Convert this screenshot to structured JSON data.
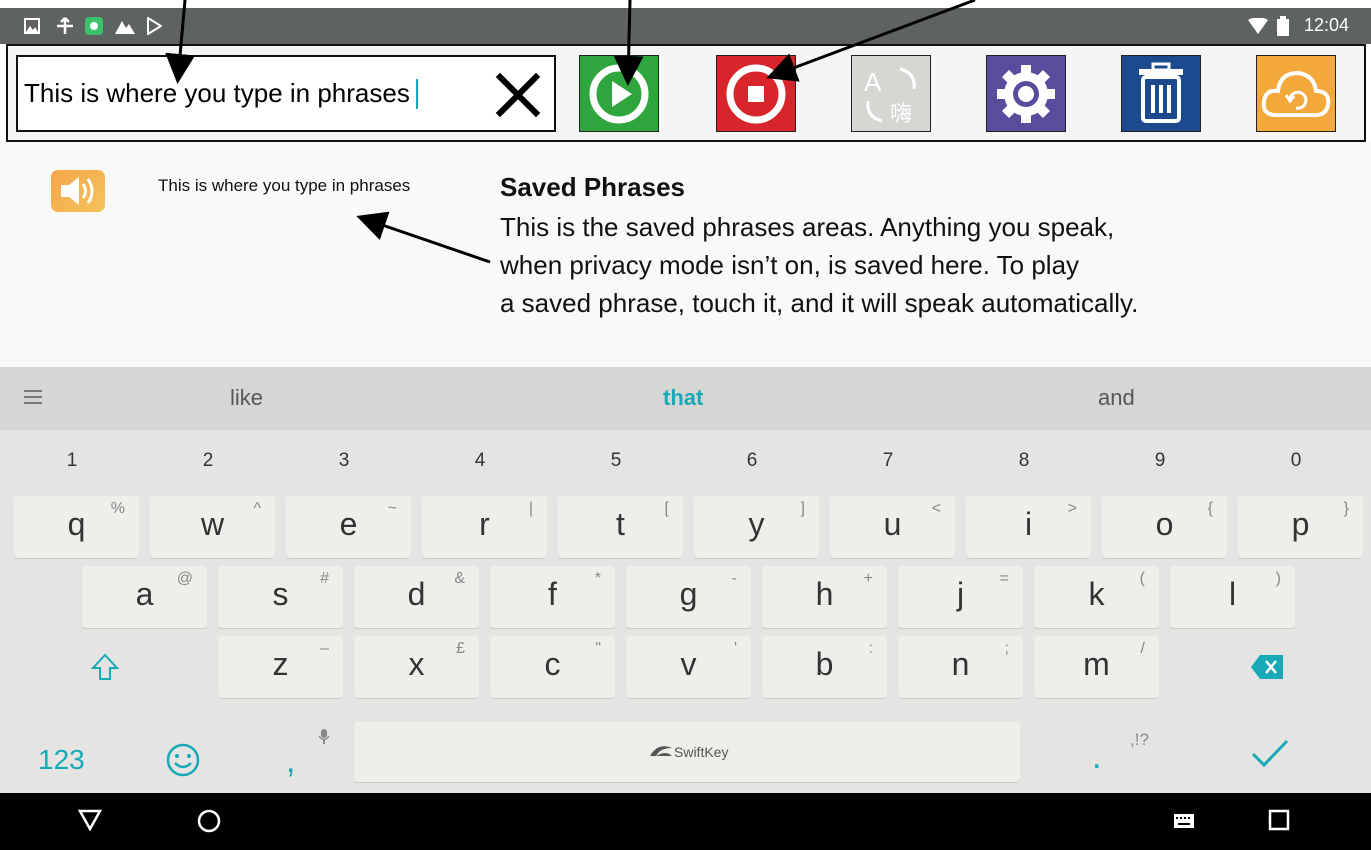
{
  "status_bar": {
    "time": "12:04",
    "left_icons": [
      "image-icon",
      "transfer-icon",
      "app-icon",
      "mountain-icon",
      "play-store-icon"
    ],
    "right_icons": [
      "wifi-icon",
      "battery-icon"
    ]
  },
  "toolbar": {
    "input_value": "This is where you type in phrases",
    "buttons": [
      {
        "name": "play-button",
        "icon": "play-icon",
        "color": "#2ea63d"
      },
      {
        "name": "stop-button",
        "icon": "stop-icon",
        "color": "#d8252b"
      },
      {
        "name": "translate-button",
        "icon": "translate-icon",
        "color": "#d6d6d3",
        "glyph_a": "A",
        "glyph_b": "嗨"
      },
      {
        "name": "settings-button",
        "icon": "gear-icon",
        "color": "#5a4b9d"
      },
      {
        "name": "delete-button",
        "icon": "trash-icon",
        "color": "#1b4a8f"
      },
      {
        "name": "sync-button",
        "icon": "cloud-sync-icon",
        "color": "#f3a83c"
      }
    ]
  },
  "saved": {
    "phrase": "This is where you type in phrases",
    "annotation_title": "Saved Phrases",
    "annotation_lines": [
      "This is the saved phrases areas. Anything you speak,",
      "when privacy mode isn’t on, is saved here. To play",
      "a saved phrase, touch it, and it will speak automatically."
    ]
  },
  "suggestions": {
    "left": "like",
    "center": "that",
    "right": "and",
    "accent": "#18a9b9"
  },
  "keyboard": {
    "numbers": [
      "1",
      "2",
      "3",
      "4",
      "5",
      "6",
      "7",
      "8",
      "9",
      "0"
    ],
    "row1": [
      {
        "k": "q",
        "a": "%"
      },
      {
        "k": "w",
        "a": "^"
      },
      {
        "k": "e",
        "a": "~"
      },
      {
        "k": "r",
        "a": "|"
      },
      {
        "k": "t",
        "a": "["
      },
      {
        "k": "y",
        "a": "]"
      },
      {
        "k": "u",
        "a": "<"
      },
      {
        "k": "i",
        "a": ">"
      },
      {
        "k": "o",
        "a": "{"
      },
      {
        "k": "p",
        "a": "}"
      }
    ],
    "row2": [
      {
        "k": "a",
        "a": "@"
      },
      {
        "k": "s",
        "a": "#"
      },
      {
        "k": "d",
        "a": "&"
      },
      {
        "k": "f",
        "a": "*"
      },
      {
        "k": "g",
        "a": "-"
      },
      {
        "k": "h",
        "a": "+"
      },
      {
        "k": "j",
        "a": "="
      },
      {
        "k": "k",
        "a": "("
      },
      {
        "k": "l",
        "a": ")"
      }
    ],
    "row3": [
      {
        "k": "z",
        "a": "–"
      },
      {
        "k": "x",
        "a": "£"
      },
      {
        "k": "c",
        "a": "\""
      },
      {
        "k": "v",
        "a": "'"
      },
      {
        "k": "b",
        "a": ":"
      },
      {
        "k": "n",
        "a": ";"
      },
      {
        "k": "m",
        "a": "/"
      }
    ],
    "num_key": "123",
    "comma": ",",
    "period": ".",
    "punct_alt": ",!?",
    "space_brand": "SwiftKey"
  },
  "nav": {
    "icons": [
      "back-icon",
      "home-icon",
      "keyboard-switch-icon",
      "recents-icon"
    ]
  }
}
